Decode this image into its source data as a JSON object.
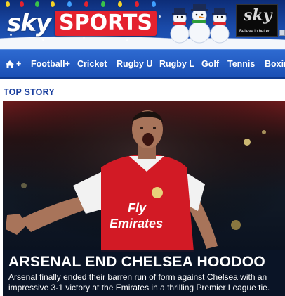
{
  "header": {
    "logo_sky": "sky",
    "logo_sports": "SPORTS",
    "ad": {
      "logo": "sky",
      "tagline": "Believe in better"
    },
    "colors": {
      "brand_blue": "#1a4aa8",
      "brand_red": "#e4222f"
    }
  },
  "nav": {
    "home_label": "+",
    "home_icon": "home-icon",
    "items": [
      {
        "label": "Football+"
      },
      {
        "label": "Cricket"
      },
      {
        "label": "Rugby U"
      },
      {
        "label": "Rugby L"
      },
      {
        "label": "Golf"
      },
      {
        "label": "Tennis"
      },
      {
        "label": "Boxing"
      }
    ]
  },
  "main": {
    "section_title": "TOP STORY",
    "story": {
      "headline": "ARSENAL END CHELSEA HOODOO",
      "summary": "Arsenal finally ended their barren run of form against Chelsea with an impressive 3-1 victory at the Emirates in a thrilling Premier League tie.",
      "shirt_text_top": "Fly",
      "shirt_text_bottom": "Emirates"
    }
  }
}
